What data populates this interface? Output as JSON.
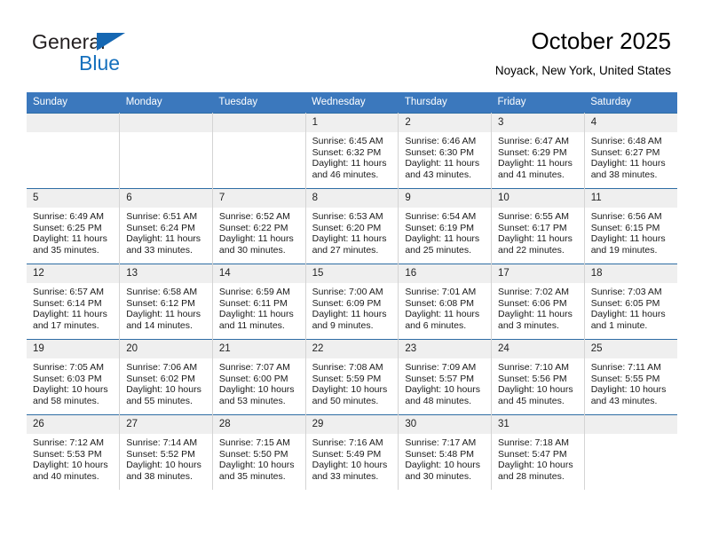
{
  "brand": {
    "name_top": "General",
    "name_bottom": "Blue",
    "triangle_icon": "blue-triangle-logo-mark",
    "color_dark": "#231f20",
    "color_blue": "#1570bd"
  },
  "header": {
    "title": "October 2025",
    "subtitle": "Noyack, New York, United States"
  },
  "theme": {
    "header_band": "#3b78bd",
    "row_divider": "#2e6da4",
    "daynum_band": "#efefef"
  },
  "weekdays": [
    "Sunday",
    "Monday",
    "Tuesday",
    "Wednesday",
    "Thursday",
    "Friday",
    "Saturday"
  ],
  "weeks": [
    [
      {
        "day": "",
        "empty": true,
        "sunrise": "",
        "sunset": "",
        "daylight_line1": "",
        "daylight_line2": ""
      },
      {
        "day": "",
        "empty": true,
        "sunrise": "",
        "sunset": "",
        "daylight_line1": "",
        "daylight_line2": ""
      },
      {
        "day": "",
        "empty": true,
        "sunrise": "",
        "sunset": "",
        "daylight_line1": "",
        "daylight_line2": ""
      },
      {
        "day": "1",
        "empty": false,
        "sunrise": "Sunrise: 6:45 AM",
        "sunset": "Sunset: 6:32 PM",
        "daylight_line1": "Daylight: 11 hours",
        "daylight_line2": "and 46 minutes."
      },
      {
        "day": "2",
        "empty": false,
        "sunrise": "Sunrise: 6:46 AM",
        "sunset": "Sunset: 6:30 PM",
        "daylight_line1": "Daylight: 11 hours",
        "daylight_line2": "and 43 minutes."
      },
      {
        "day": "3",
        "empty": false,
        "sunrise": "Sunrise: 6:47 AM",
        "sunset": "Sunset: 6:29 PM",
        "daylight_line1": "Daylight: 11 hours",
        "daylight_line2": "and 41 minutes."
      },
      {
        "day": "4",
        "empty": false,
        "sunrise": "Sunrise: 6:48 AM",
        "sunset": "Sunset: 6:27 PM",
        "daylight_line1": "Daylight: 11 hours",
        "daylight_line2": "and 38 minutes."
      }
    ],
    [
      {
        "day": "5",
        "empty": false,
        "sunrise": "Sunrise: 6:49 AM",
        "sunset": "Sunset: 6:25 PM",
        "daylight_line1": "Daylight: 11 hours",
        "daylight_line2": "and 35 minutes."
      },
      {
        "day": "6",
        "empty": false,
        "sunrise": "Sunrise: 6:51 AM",
        "sunset": "Sunset: 6:24 PM",
        "daylight_line1": "Daylight: 11 hours",
        "daylight_line2": "and 33 minutes."
      },
      {
        "day": "7",
        "empty": false,
        "sunrise": "Sunrise: 6:52 AM",
        "sunset": "Sunset: 6:22 PM",
        "daylight_line1": "Daylight: 11 hours",
        "daylight_line2": "and 30 minutes."
      },
      {
        "day": "8",
        "empty": false,
        "sunrise": "Sunrise: 6:53 AM",
        "sunset": "Sunset: 6:20 PM",
        "daylight_line1": "Daylight: 11 hours",
        "daylight_line2": "and 27 minutes."
      },
      {
        "day": "9",
        "empty": false,
        "sunrise": "Sunrise: 6:54 AM",
        "sunset": "Sunset: 6:19 PM",
        "daylight_line1": "Daylight: 11 hours",
        "daylight_line2": "and 25 minutes."
      },
      {
        "day": "10",
        "empty": false,
        "sunrise": "Sunrise: 6:55 AM",
        "sunset": "Sunset: 6:17 PM",
        "daylight_line1": "Daylight: 11 hours",
        "daylight_line2": "and 22 minutes."
      },
      {
        "day": "11",
        "empty": false,
        "sunrise": "Sunrise: 6:56 AM",
        "sunset": "Sunset: 6:15 PM",
        "daylight_line1": "Daylight: 11 hours",
        "daylight_line2": "and 19 minutes."
      }
    ],
    [
      {
        "day": "12",
        "empty": false,
        "sunrise": "Sunrise: 6:57 AM",
        "sunset": "Sunset: 6:14 PM",
        "daylight_line1": "Daylight: 11 hours",
        "daylight_line2": "and 17 minutes."
      },
      {
        "day": "13",
        "empty": false,
        "sunrise": "Sunrise: 6:58 AM",
        "sunset": "Sunset: 6:12 PM",
        "daylight_line1": "Daylight: 11 hours",
        "daylight_line2": "and 14 minutes."
      },
      {
        "day": "14",
        "empty": false,
        "sunrise": "Sunrise: 6:59 AM",
        "sunset": "Sunset: 6:11 PM",
        "daylight_line1": "Daylight: 11 hours",
        "daylight_line2": "and 11 minutes."
      },
      {
        "day": "15",
        "empty": false,
        "sunrise": "Sunrise: 7:00 AM",
        "sunset": "Sunset: 6:09 PM",
        "daylight_line1": "Daylight: 11 hours",
        "daylight_line2": "and 9 minutes."
      },
      {
        "day": "16",
        "empty": false,
        "sunrise": "Sunrise: 7:01 AM",
        "sunset": "Sunset: 6:08 PM",
        "daylight_line1": "Daylight: 11 hours",
        "daylight_line2": "and 6 minutes."
      },
      {
        "day": "17",
        "empty": false,
        "sunrise": "Sunrise: 7:02 AM",
        "sunset": "Sunset: 6:06 PM",
        "daylight_line1": "Daylight: 11 hours",
        "daylight_line2": "and 3 minutes."
      },
      {
        "day": "18",
        "empty": false,
        "sunrise": "Sunrise: 7:03 AM",
        "sunset": "Sunset: 6:05 PM",
        "daylight_line1": "Daylight: 11 hours",
        "daylight_line2": "and 1 minute."
      }
    ],
    [
      {
        "day": "19",
        "empty": false,
        "sunrise": "Sunrise: 7:05 AM",
        "sunset": "Sunset: 6:03 PM",
        "daylight_line1": "Daylight: 10 hours",
        "daylight_line2": "and 58 minutes."
      },
      {
        "day": "20",
        "empty": false,
        "sunrise": "Sunrise: 7:06 AM",
        "sunset": "Sunset: 6:02 PM",
        "daylight_line1": "Daylight: 10 hours",
        "daylight_line2": "and 55 minutes."
      },
      {
        "day": "21",
        "empty": false,
        "sunrise": "Sunrise: 7:07 AM",
        "sunset": "Sunset: 6:00 PM",
        "daylight_line1": "Daylight: 10 hours",
        "daylight_line2": "and 53 minutes."
      },
      {
        "day": "22",
        "empty": false,
        "sunrise": "Sunrise: 7:08 AM",
        "sunset": "Sunset: 5:59 PM",
        "daylight_line1": "Daylight: 10 hours",
        "daylight_line2": "and 50 minutes."
      },
      {
        "day": "23",
        "empty": false,
        "sunrise": "Sunrise: 7:09 AM",
        "sunset": "Sunset: 5:57 PM",
        "daylight_line1": "Daylight: 10 hours",
        "daylight_line2": "and 48 minutes."
      },
      {
        "day": "24",
        "empty": false,
        "sunrise": "Sunrise: 7:10 AM",
        "sunset": "Sunset: 5:56 PM",
        "daylight_line1": "Daylight: 10 hours",
        "daylight_line2": "and 45 minutes."
      },
      {
        "day": "25",
        "empty": false,
        "sunrise": "Sunrise: 7:11 AM",
        "sunset": "Sunset: 5:55 PM",
        "daylight_line1": "Daylight: 10 hours",
        "daylight_line2": "and 43 minutes."
      }
    ],
    [
      {
        "day": "26",
        "empty": false,
        "sunrise": "Sunrise: 7:12 AM",
        "sunset": "Sunset: 5:53 PM",
        "daylight_line1": "Daylight: 10 hours",
        "daylight_line2": "and 40 minutes."
      },
      {
        "day": "27",
        "empty": false,
        "sunrise": "Sunrise: 7:14 AM",
        "sunset": "Sunset: 5:52 PM",
        "daylight_line1": "Daylight: 10 hours",
        "daylight_line2": "and 38 minutes."
      },
      {
        "day": "28",
        "empty": false,
        "sunrise": "Sunrise: 7:15 AM",
        "sunset": "Sunset: 5:50 PM",
        "daylight_line1": "Daylight: 10 hours",
        "daylight_line2": "and 35 minutes."
      },
      {
        "day": "29",
        "empty": false,
        "sunrise": "Sunrise: 7:16 AM",
        "sunset": "Sunset: 5:49 PM",
        "daylight_line1": "Daylight: 10 hours",
        "daylight_line2": "and 33 minutes."
      },
      {
        "day": "30",
        "empty": false,
        "sunrise": "Sunrise: 7:17 AM",
        "sunset": "Sunset: 5:48 PM",
        "daylight_line1": "Daylight: 10 hours",
        "daylight_line2": "and 30 minutes."
      },
      {
        "day": "31",
        "empty": false,
        "sunrise": "Sunrise: 7:18 AM",
        "sunset": "Sunset: 5:47 PM",
        "daylight_line1": "Daylight: 10 hours",
        "daylight_line2": "and 28 minutes."
      },
      {
        "day": "",
        "empty": true,
        "sunrise": "",
        "sunset": "",
        "daylight_line1": "",
        "daylight_line2": ""
      }
    ]
  ]
}
